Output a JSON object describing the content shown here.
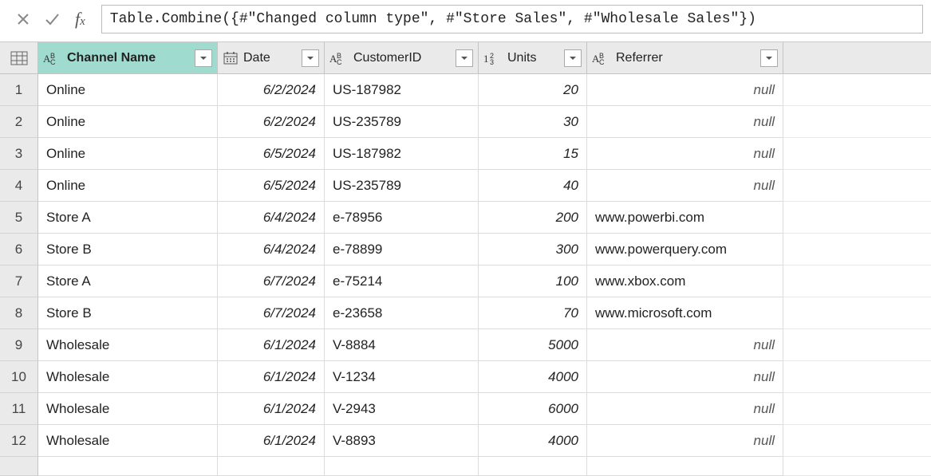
{
  "formula": "Table.Combine({#\"Changed column type\", #\"Store Sales\", #\"Wholesale Sales\"})",
  "cols": {
    "channel": "Channel Name",
    "date": "Date",
    "customer": "CustomerID",
    "units": "Units",
    "referrer": "Referrer"
  },
  "null_text": "null",
  "rows": [
    {
      "n": "1",
      "channel": "Online",
      "date": "6/2/2024",
      "customer": "US-187982",
      "units": "20",
      "referrer": null
    },
    {
      "n": "2",
      "channel": "Online",
      "date": "6/2/2024",
      "customer": "US-235789",
      "units": "30",
      "referrer": null
    },
    {
      "n": "3",
      "channel": "Online",
      "date": "6/5/2024",
      "customer": "US-187982",
      "units": "15",
      "referrer": null
    },
    {
      "n": "4",
      "channel": "Online",
      "date": "6/5/2024",
      "customer": "US-235789",
      "units": "40",
      "referrer": null
    },
    {
      "n": "5",
      "channel": "Store A",
      "date": "6/4/2024",
      "customer": "e-78956",
      "units": "200",
      "referrer": "www.powerbi.com"
    },
    {
      "n": "6",
      "channel": "Store B",
      "date": "6/4/2024",
      "customer": "e-78899",
      "units": "300",
      "referrer": "www.powerquery.com"
    },
    {
      "n": "7",
      "channel": "Store A",
      "date": "6/7/2024",
      "customer": "e-75214",
      "units": "100",
      "referrer": "www.xbox.com"
    },
    {
      "n": "8",
      "channel": "Store B",
      "date": "6/7/2024",
      "customer": "e-23658",
      "units": "70",
      "referrer": "www.microsoft.com"
    },
    {
      "n": "9",
      "channel": "Wholesale",
      "date": "6/1/2024",
      "customer": "V-8884",
      "units": "5000",
      "referrer": null
    },
    {
      "n": "10",
      "channel": "Wholesale",
      "date": "6/1/2024",
      "customer": "V-1234",
      "units": "4000",
      "referrer": null
    },
    {
      "n": "11",
      "channel": "Wholesale",
      "date": "6/1/2024",
      "customer": "V-2943",
      "units": "6000",
      "referrer": null
    },
    {
      "n": "12",
      "channel": "Wholesale",
      "date": "6/1/2024",
      "customer": "V-8893",
      "units": "4000",
      "referrer": null
    }
  ]
}
